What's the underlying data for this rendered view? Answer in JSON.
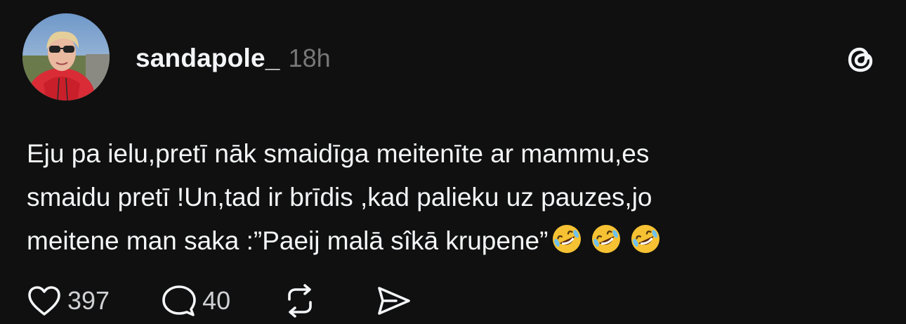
{
  "post": {
    "author": "sandapole_",
    "time_ago": "18h",
    "body_lines": [
      "Eju pa ielu,pretī nāk smaidīga meitenīte ar mammu,es",
      "smaidu pretī !Un,tad ir brīdis ,kad palieku uz pauzes,jo",
      "meitene man saka :”Paeij malā sîkā krupene”"
    ],
    "emojis": [
      "rolling-on-floor-laughing",
      "rolling-on-floor-laughing",
      "rolling-on-floor-laughing"
    ],
    "likes": "397",
    "replies": "40"
  },
  "icons": {
    "platform_logo": "threads-icon",
    "like": "heart-icon",
    "reply": "comment-bubble-icon",
    "repost": "repost-icon",
    "share": "send-icon"
  },
  "colors": {
    "background": "#101010",
    "text": "#f3f5f7",
    "muted": "#777777"
  }
}
